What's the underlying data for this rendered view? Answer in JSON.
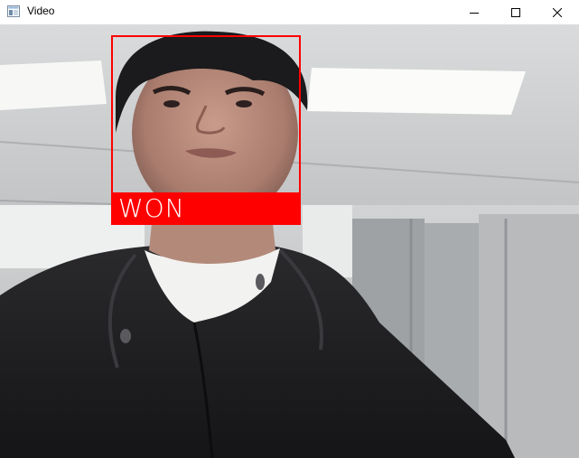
{
  "window": {
    "title": "Video",
    "icon": "window-app-icon",
    "controls": [
      "minimize-icon",
      "maximize-icon",
      "close-icon"
    ]
  },
  "detection": {
    "label": "WON",
    "box_color": "#ff0000",
    "label_text_color": "#ffffff"
  }
}
